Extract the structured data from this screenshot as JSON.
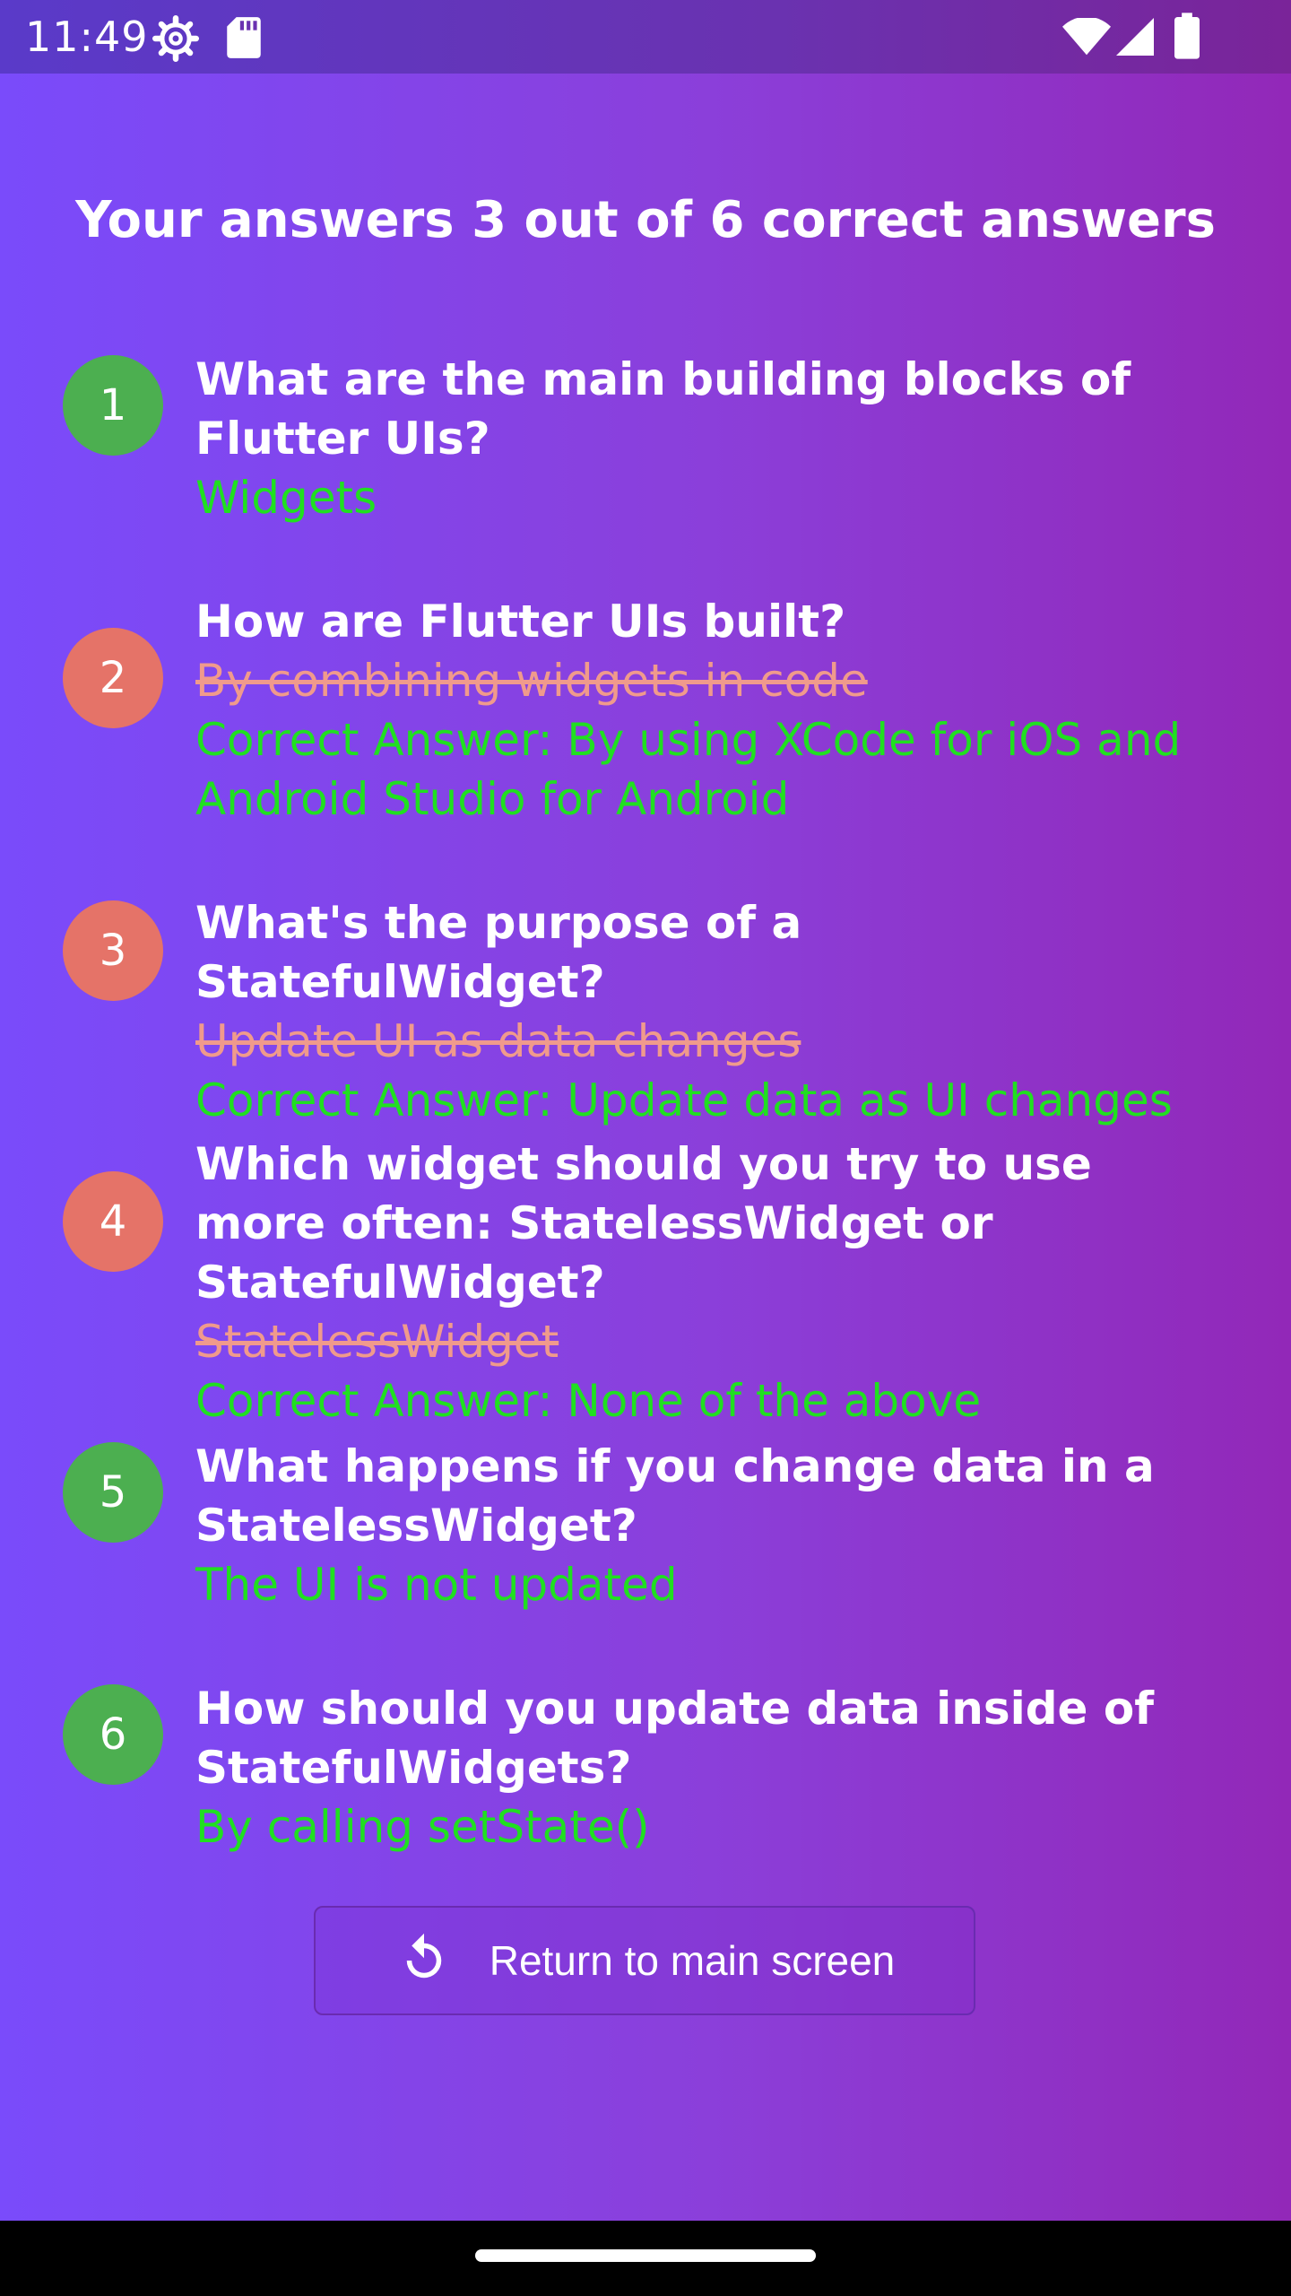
{
  "status_bar": {
    "time": "11:49"
  },
  "title": "Your answers 3 out of 6 correct answers",
  "answers": [
    {
      "number": "1",
      "status": "correct",
      "question": "What are the main building blocks of Flutter UIs?",
      "given": "Widgets",
      "correct_answer": ""
    },
    {
      "number": "2",
      "status": "wrong",
      "question": "How are Flutter UIs built?",
      "given": "By combining widgets in code",
      "correct_answer": "Correct Answer: By using XCode for iOS and Android Studio for Android"
    },
    {
      "number": "3",
      "status": "wrong",
      "question": "What's the purpose of a StatefulWidget?",
      "given": "Update UI as data changes",
      "correct_answer": "Correct Answer: Update data as UI changes"
    },
    {
      "number": "4",
      "status": "wrong",
      "question": "Which widget should you try to use more often: StatelessWidget or StatefulWidget?",
      "given": "StatelessWidget",
      "correct_answer": "Correct Answer: None of the above"
    },
    {
      "number": "5",
      "status": "correct",
      "question": "What happens if you change data in a StatelessWidget?",
      "given": "The UI is not updated",
      "correct_answer": ""
    },
    {
      "number": "6",
      "status": "correct",
      "question": "How should you update data inside of StatefulWidgets?",
      "given": "By calling setState()",
      "correct_answer": ""
    }
  ],
  "return_button": {
    "label": "Return to main screen",
    "icon": "restart-icon"
  },
  "colors": {
    "correct_badge": "#4caf50",
    "wrong_badge": "#e57368",
    "correct_text": "#20e020",
    "wrong_text": "#f09a8c"
  }
}
